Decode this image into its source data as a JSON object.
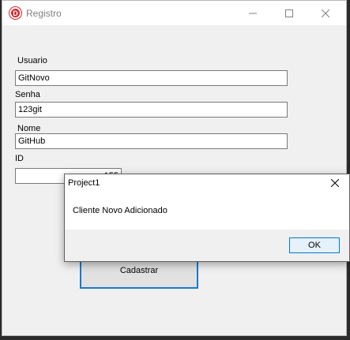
{
  "window": {
    "title": "Registro",
    "icon_name": "delphi-app-icon",
    "icon_glyph": "D",
    "controls": {
      "minimize": "minimize-icon",
      "maximize": "maximize-icon",
      "close": "close-icon"
    }
  },
  "form": {
    "usuario_label": "Usuario",
    "usuario_value": "GitNovo",
    "senha_label": "Senha",
    "senha_value": "123git",
    "nome_label": "Nome",
    "nome_value": "GitHub",
    "id_label": "ID",
    "id_value": "155",
    "submit_label": "Cadastrar"
  },
  "dialog": {
    "title": "Project1",
    "message": "Cliente Novo Adicionado",
    "ok_label": "OK"
  },
  "colors": {
    "accent": "#1c7ac9",
    "app_icon": "#d9232d"
  }
}
